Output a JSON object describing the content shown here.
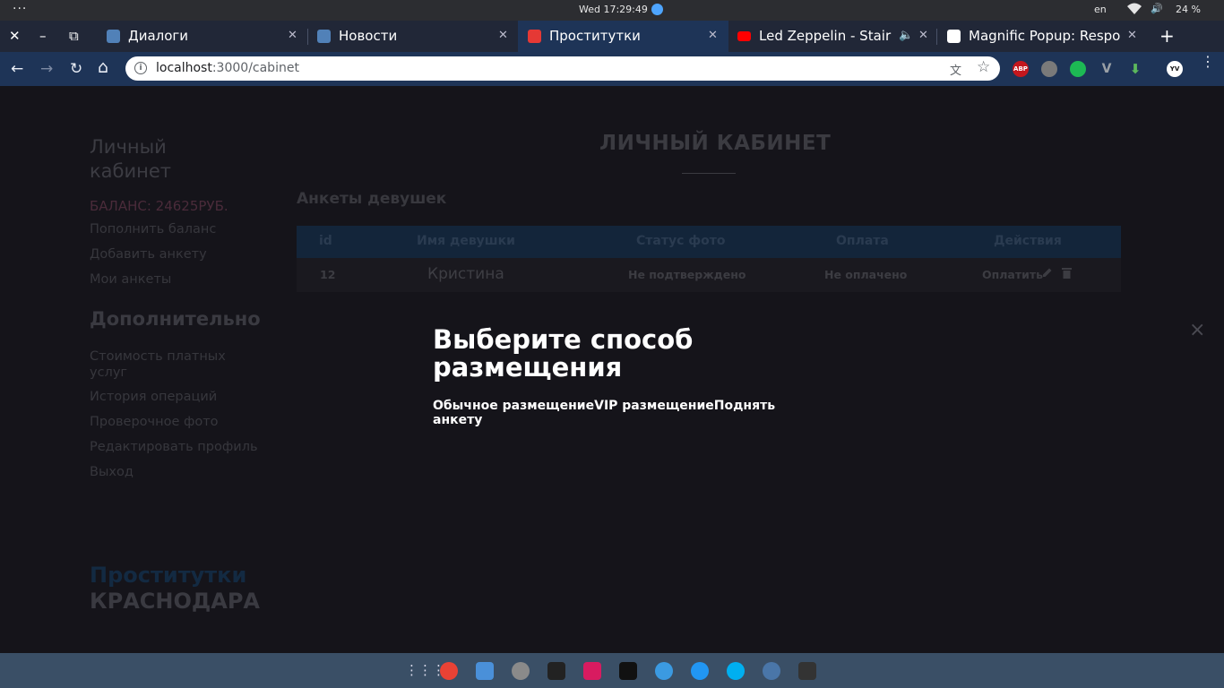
{
  "os": {
    "menu_dots": "···",
    "clock": "Wed 17:29:49",
    "lang": "en",
    "wifi_icon": "▾",
    "volume_icon": "🔊",
    "battery": "24 %"
  },
  "window": {
    "close": "✕",
    "minimize": "–",
    "restore": "⧉"
  },
  "tabs": [
    {
      "title": "Диалоги",
      "favicon_color": "#5181b8",
      "close": "✕"
    },
    {
      "title": "Новости",
      "favicon_color": "#5181b8",
      "close": "✕"
    },
    {
      "title": "Проститутки",
      "favicon_color": "#e53935",
      "close": "✕"
    },
    {
      "title": "Led Zeppelin - Stair",
      "favicon_color": "#ff0000",
      "close": "✕",
      "audio": "🔈"
    },
    {
      "title": "Magnific Popup: Respo",
      "favicon_color": "#ffffff",
      "close": "✕"
    }
  ],
  "new_tab": "+",
  "nav": {
    "back": "←",
    "forward": "→",
    "reload": "↻",
    "home": "⌂"
  },
  "address": {
    "info": "i",
    "host": "localhost",
    "path": ":3000/cabinet",
    "translate_icon": "文",
    "star_icon": "☆"
  },
  "extensions": [
    {
      "label": "ABP",
      "color": "#c4171d"
    },
    {
      "label": "",
      "color": "#7a7a7a"
    },
    {
      "label": "",
      "color": "#1db954"
    },
    {
      "label": "V",
      "color": "#9aa0a6"
    },
    {
      "label": "⬇",
      "color": "#5cb85c"
    },
    {
      "label": "YV",
      "color": "#ffffff"
    }
  ],
  "menu": "⋮",
  "sidebar": {
    "title": "Личный кабинет",
    "balance": "БАЛАНС: 24625РУБ.",
    "links": [
      "Пополнить баланс",
      "Добавить анкету",
      "Мои анкеты"
    ],
    "extra_title": "Дополнительно",
    "extra_links": [
      "Стоимость платных услуг",
      "История операций",
      "Проверочное фото",
      "Редактировать профиль",
      "Выход"
    ],
    "brand_line1": "Проститутки",
    "brand_line2": "КРАСНОДАРА"
  },
  "main": {
    "title": "ЛИЧНЫЙ КАБИНЕТ",
    "section": "Анкеты девушек",
    "table": {
      "headers": [
        "id",
        "Имя девушки",
        "Статус фото",
        "Оплата",
        "Действия"
      ],
      "rows": [
        {
          "id": "12",
          "name": "Кристина",
          "photo_status": "Не подтверждено",
          "payment": "Не оплачено",
          "action": "Оплатить"
        }
      ]
    }
  },
  "modal": {
    "title": "Выберите способ размещения",
    "options": [
      "Обычное размещение",
      "VIP размещение",
      "Поднять анкету"
    ],
    "close": "×"
  },
  "taskbar": {
    "apps": [
      {
        "name": "apps-grid",
        "color": "#3a4f66"
      },
      {
        "name": "chrome",
        "color": "#e94235"
      },
      {
        "name": "finder",
        "color": "#4a90d9"
      },
      {
        "name": "settings",
        "color": "#8a8a8a"
      },
      {
        "name": "terminal",
        "color": "#222222"
      },
      {
        "name": "rubymine",
        "color": "#d81b60"
      },
      {
        "name": "intellij",
        "color": "#111111"
      },
      {
        "name": "atom",
        "color": "#3b9ae1"
      },
      {
        "name": "drive",
        "color": "#2196f3"
      },
      {
        "name": "skype",
        "color": "#00aff0"
      },
      {
        "name": "vk",
        "color": "#4a76a8"
      },
      {
        "name": "editor",
        "color": "#333333"
      }
    ]
  }
}
